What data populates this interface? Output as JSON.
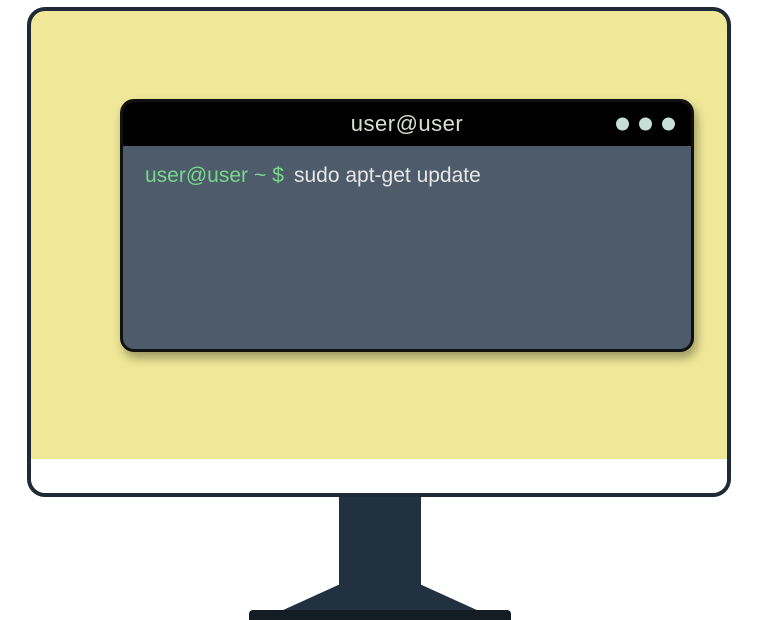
{
  "terminal": {
    "title": "user@user",
    "prompt_user_host": "user@user",
    "prompt_tilde": "~",
    "prompt_symbol": "$",
    "command": "sudo apt-get update"
  }
}
